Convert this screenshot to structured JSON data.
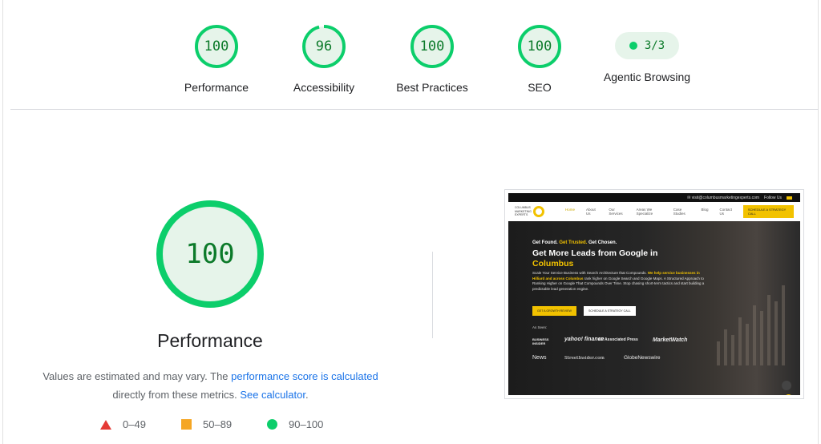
{
  "gauges": [
    {
      "score": "100",
      "label": "Performance",
      "value": 1.0
    },
    {
      "score": "96",
      "label": "Accessibility",
      "value": 0.96
    },
    {
      "score": "100",
      "label": "Best Practices",
      "value": 1.0
    },
    {
      "score": "100",
      "label": "SEO",
      "value": 1.0
    }
  ],
  "agentic": {
    "fraction": "3/3",
    "label": "Agentic Browsing"
  },
  "performance": {
    "score": "100",
    "title": "Performance",
    "note_prefix": "Values are estimated and may vary. The ",
    "note_link": "performance score is calculated",
    "note_middle": "directly from these metrics. ",
    "note_link2": "See calculator",
    "note_suffix": "."
  },
  "legend": [
    {
      "range": "0–49",
      "shape": "triangle",
      "color": "#e53935"
    },
    {
      "range": "50–89",
      "shape": "square",
      "color": "#f5a623"
    },
    {
      "range": "90–100",
      "shape": "circle",
      "color": "#0cce6b"
    }
  ],
  "colors": {
    "pass": "#0cce6b",
    "pass_text": "#0c7a2a",
    "pass_bg": "#e6f4ea",
    "brand_yellow": "#f2c200"
  },
  "thumbnail": {
    "topbar_email": "✉ visit@columbusmarketingexperts.com",
    "topbar_follow": "Follow Us",
    "logo_text": "COLUMBUS MARKETING EXPERTS",
    "nav": [
      "Home",
      "About Us",
      "Our Services",
      "Areas We Specialize",
      "Case Studies",
      "Blog",
      "Contact Us"
    ],
    "nav_cta": "SCHEDULE A STRATEGY CALL",
    "kicker_1": "Get Found. ",
    "kicker_2": "Get Trusted.",
    "kicker_3": " Get Chosen.",
    "headline_1": "Get More Leads from Google in ",
    "headline_2": "Columbus",
    "body_1": "Scale Your Service Business with Search Architecture that Compounds. ",
    "body_2": "We help service businesses in Hilliard and across Columbus",
    "body_3": " rank higher on Google Search and Google Maps. A Structured Approach to Ranking Higher on Google That Compounds Over Time. Stop chasing short-term tactics and start building a predictable lead generation engine.",
    "btn_primary": "GET A GROWTH REVIEW",
    "btn_secondary": "SCHEDULE A STRATEGY CALL",
    "as_seen": "As Seen:",
    "press": [
      "BUSINESS INSIDER",
      "yahoo! finance",
      "AP Associated Press",
      "MarketWatch",
      "News",
      "StreetInsider.com",
      "GlobeNewswire"
    ]
  }
}
